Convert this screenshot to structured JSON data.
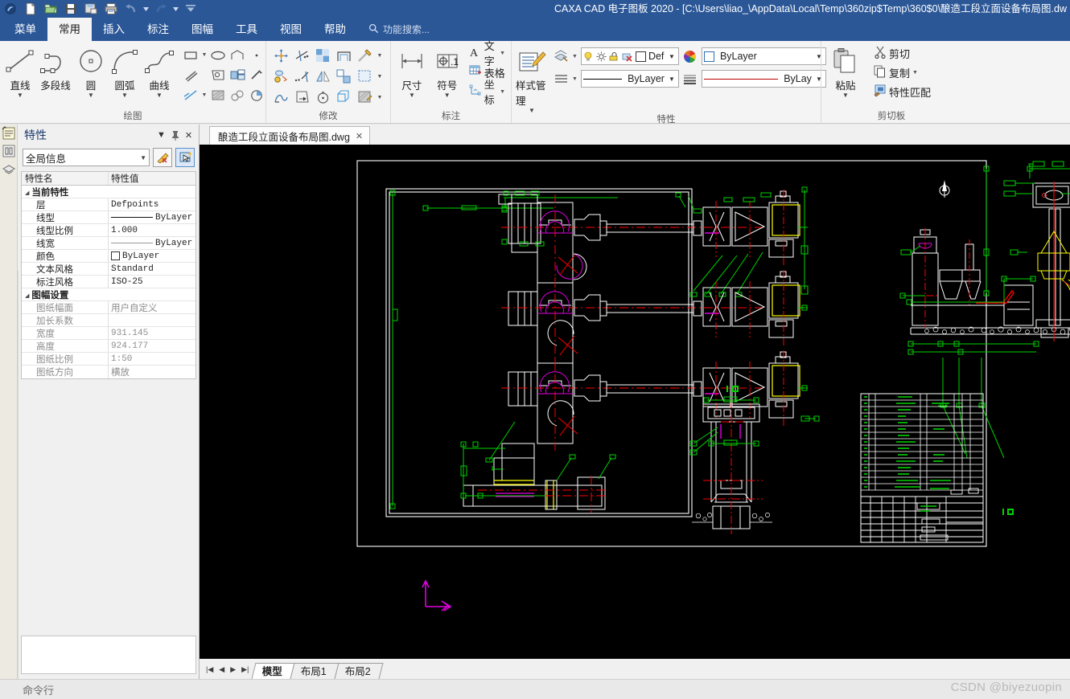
{
  "window": {
    "title": "CAXA CAD 电子图板 2020 - [C:\\Users\\liao_\\AppData\\Local\\Temp\\360zip$Temp\\360$0\\酿造工段立面设备布局图.dw",
    "accent": "#2b5797"
  },
  "quick_access": [
    {
      "name": "app-logo-icon",
      "label": "CAXA"
    },
    {
      "name": "new-file-icon",
      "label": "新建"
    },
    {
      "name": "open-file-icon",
      "label": "打开"
    },
    {
      "name": "save-file-icon",
      "label": "保存"
    },
    {
      "name": "save-as-icon",
      "label": "另存为"
    },
    {
      "name": "print-icon",
      "label": "打印"
    },
    {
      "name": "undo-icon",
      "label": "撤销"
    },
    {
      "name": "undo-dropdown-icon",
      "label": "撤销列表"
    },
    {
      "name": "redo-icon",
      "label": "恢复"
    },
    {
      "name": "redo-dropdown-icon",
      "label": "恢复列表"
    },
    {
      "name": "customize-qat-icon",
      "label": "自定义快速启动工具栏"
    }
  ],
  "ribbon": {
    "tabs": [
      {
        "label": "菜单",
        "active": false
      },
      {
        "label": "常用",
        "active": true
      },
      {
        "label": "插入",
        "active": false
      },
      {
        "label": "标注",
        "active": false
      },
      {
        "label": "图幅",
        "active": false
      },
      {
        "label": "工具",
        "active": false
      },
      {
        "label": "视图",
        "active": false
      },
      {
        "label": "帮助",
        "active": false
      }
    ],
    "search_placeholder": "功能搜索...",
    "panels": {
      "draw": {
        "title": "绘图",
        "big_buttons": [
          {
            "label": "直线",
            "icon": "line-icon",
            "has_arrow": true
          },
          {
            "label": "多段线",
            "icon": "polyline-icon",
            "has_arrow": false
          },
          {
            "label": "圆",
            "icon": "circle-icon",
            "has_arrow": true
          },
          {
            "label": "圆弧",
            "icon": "arc-icon",
            "has_arrow": true
          },
          {
            "label": "曲线",
            "icon": "spline-icon",
            "has_arrow": true
          }
        ],
        "small_icons": [
          "rectangle-icon",
          "rectangle-dropdown-icon",
          "ellipse-icon",
          "polygon-icon",
          "point-icon",
          "centerline-icon",
          "image-icon",
          "block-create-icon",
          "cloud-revision-icon",
          "construction-line-icon",
          "construction-dropdown-icon",
          "hatch-icon",
          "equation-curve-icon",
          "local-magnify-icon"
        ]
      },
      "modify": {
        "title": "修改",
        "icons": [
          "move-icon",
          "trim-icon",
          "array-icon",
          "offset-icon",
          "chamfer-icon",
          "chamfer-dropdown-icon",
          "copy-move-icon",
          "extend-icon",
          "mirror-icon",
          "break-icon",
          "scale-icon",
          "scale-dropdown-icon",
          "stretch-icon",
          "rotate-trim-icon",
          "rotate-icon",
          "explode-icon",
          "edit-hatch-icon",
          "edit-dropdown-icon"
        ]
      },
      "annotation": {
        "title": "标注",
        "big_buttons": [
          {
            "label": "尺寸",
            "icon": "dimension-icon",
            "has_arrow": true
          },
          {
            "label": "符号",
            "icon": "symbol-icon",
            "has_arrow": true
          }
        ],
        "text_buttons": [
          {
            "label": "文字",
            "icon": "text-icon",
            "has_arrow": true
          },
          {
            "label": "表格",
            "icon": "table-icon",
            "has_arrow": false
          },
          {
            "label": "坐标",
            "icon": "coordinate-icon",
            "has_arrow": true
          }
        ]
      },
      "properties": {
        "title": "特性",
        "style_manager": {
          "label": "样式管理",
          "icon": "style-manager-icon",
          "has_arrow": true
        },
        "layer_tools_icon": "layer-tools-icon",
        "linetype_tools_icon": "linetype-list-icon",
        "color_wheel_icon": "color-wheel-icon",
        "lineweight_tools_icon": "lineweight-list-icon",
        "layer_combo": {
          "value": "Def",
          "state_icons": [
            "lightbulb-icon",
            "sun-icon",
            "freeze-icon",
            "lock-plot-icon",
            "color-swatch-icon"
          ]
        },
        "color_combo": {
          "value": "ByLayer",
          "swatch": "#ffffff"
        },
        "linetype_combo": {
          "value": "ByLayer"
        },
        "lineweight_combo": {
          "value": "ByLay",
          "color": "#c00000"
        }
      },
      "clipboard": {
        "title": "剪切板",
        "paste": {
          "label": "粘贴",
          "icon": "paste-icon",
          "has_arrow": true
        },
        "items": [
          {
            "label": "剪切",
            "icon": "cut-icon",
            "has_arrow": false
          },
          {
            "label": "复制",
            "icon": "copy-icon",
            "has_arrow": true
          },
          {
            "label": "特性匹配",
            "icon": "match-properties-icon",
            "has_arrow": false
          }
        ]
      }
    }
  },
  "left_dock_tabs": [
    {
      "name": "properties-dock-icon",
      "label": "特性"
    },
    {
      "name": "drawing-dock-icon",
      "label": "图库"
    }
  ],
  "properties_panel": {
    "title": "特性",
    "header_buttons": [
      {
        "name": "panel-menu-button",
        "glyph": "▼"
      },
      {
        "name": "panel-pin-button",
        "glyph": "📌"
      },
      {
        "name": "panel-close-button",
        "glyph": "✕"
      }
    ],
    "selector": {
      "value": "全局信息"
    },
    "tool_buttons": [
      {
        "name": "quick-select-button",
        "icon": "quick-select-icon"
      },
      {
        "name": "pick-object-button",
        "icon": "pick-object-icon",
        "active": true
      }
    ],
    "columns": [
      "特性名",
      "特性值"
    ],
    "groups": [
      {
        "name": "当前特性",
        "rows": [
          {
            "label": "层",
            "value": "Defpoints",
            "kind": "mono"
          },
          {
            "label": "线型",
            "value": "ByLayer",
            "kind": "linetype"
          },
          {
            "label": "线型比例",
            "value": "1.000",
            "kind": "mono"
          },
          {
            "label": "线宽",
            "value": "ByLayer",
            "kind": "lineweight"
          },
          {
            "label": "颜色",
            "value": "ByLayer",
            "kind": "color"
          },
          {
            "label": "文本风格",
            "value": "Standard",
            "kind": "mono"
          },
          {
            "label": "标注风格",
            "value": "ISO-25",
            "kind": "mono"
          }
        ]
      },
      {
        "name": "图幅设置",
        "rows": [
          {
            "label": "图纸幅面",
            "value": "用户自定义",
            "kind": "dim"
          },
          {
            "label": "加长系数",
            "value": "",
            "kind": "dim"
          },
          {
            "label": "宽度",
            "value": "931.145",
            "kind": "dimmono"
          },
          {
            "label": "高度",
            "value": "924.177",
            "kind": "dimmono"
          },
          {
            "label": "图纸比例",
            "value": "1:50",
            "kind": "dimmono"
          },
          {
            "label": "图纸方向",
            "value": "横放",
            "kind": "dim"
          }
        ]
      }
    ]
  },
  "document_tabs": [
    {
      "label": "酿造工段立面设备布局图.dwg",
      "active": true,
      "close": "✕"
    }
  ],
  "canvas": {
    "background": "#000000",
    "colors": {
      "white": "#ffffff",
      "green": "#00d400",
      "red": "#ff0000",
      "magenta": "#e000e0",
      "yellow": "#ffff00",
      "ucs": "#e000e0"
    },
    "drawing_title": "酿造工段立面设备布局图",
    "ucs_icon": "ucs-axis-icon",
    "north_arrow_icon": "north-arrow-icon"
  },
  "layout_tabs": {
    "nav": [
      {
        "name": "first-layout-button",
        "glyph": "|◀"
      },
      {
        "name": "prev-layout-button",
        "glyph": "◀"
      },
      {
        "name": "next-layout-button",
        "glyph": "▶"
      },
      {
        "name": "last-layout-button",
        "glyph": "▶|"
      }
    ],
    "tabs": [
      {
        "label": "模型",
        "active": true
      },
      {
        "label": "布局1",
        "active": false
      },
      {
        "label": "布局2",
        "active": false
      }
    ]
  },
  "command_bar": {
    "label": "命令行"
  },
  "watermark": "CSDN @biyezuopin"
}
